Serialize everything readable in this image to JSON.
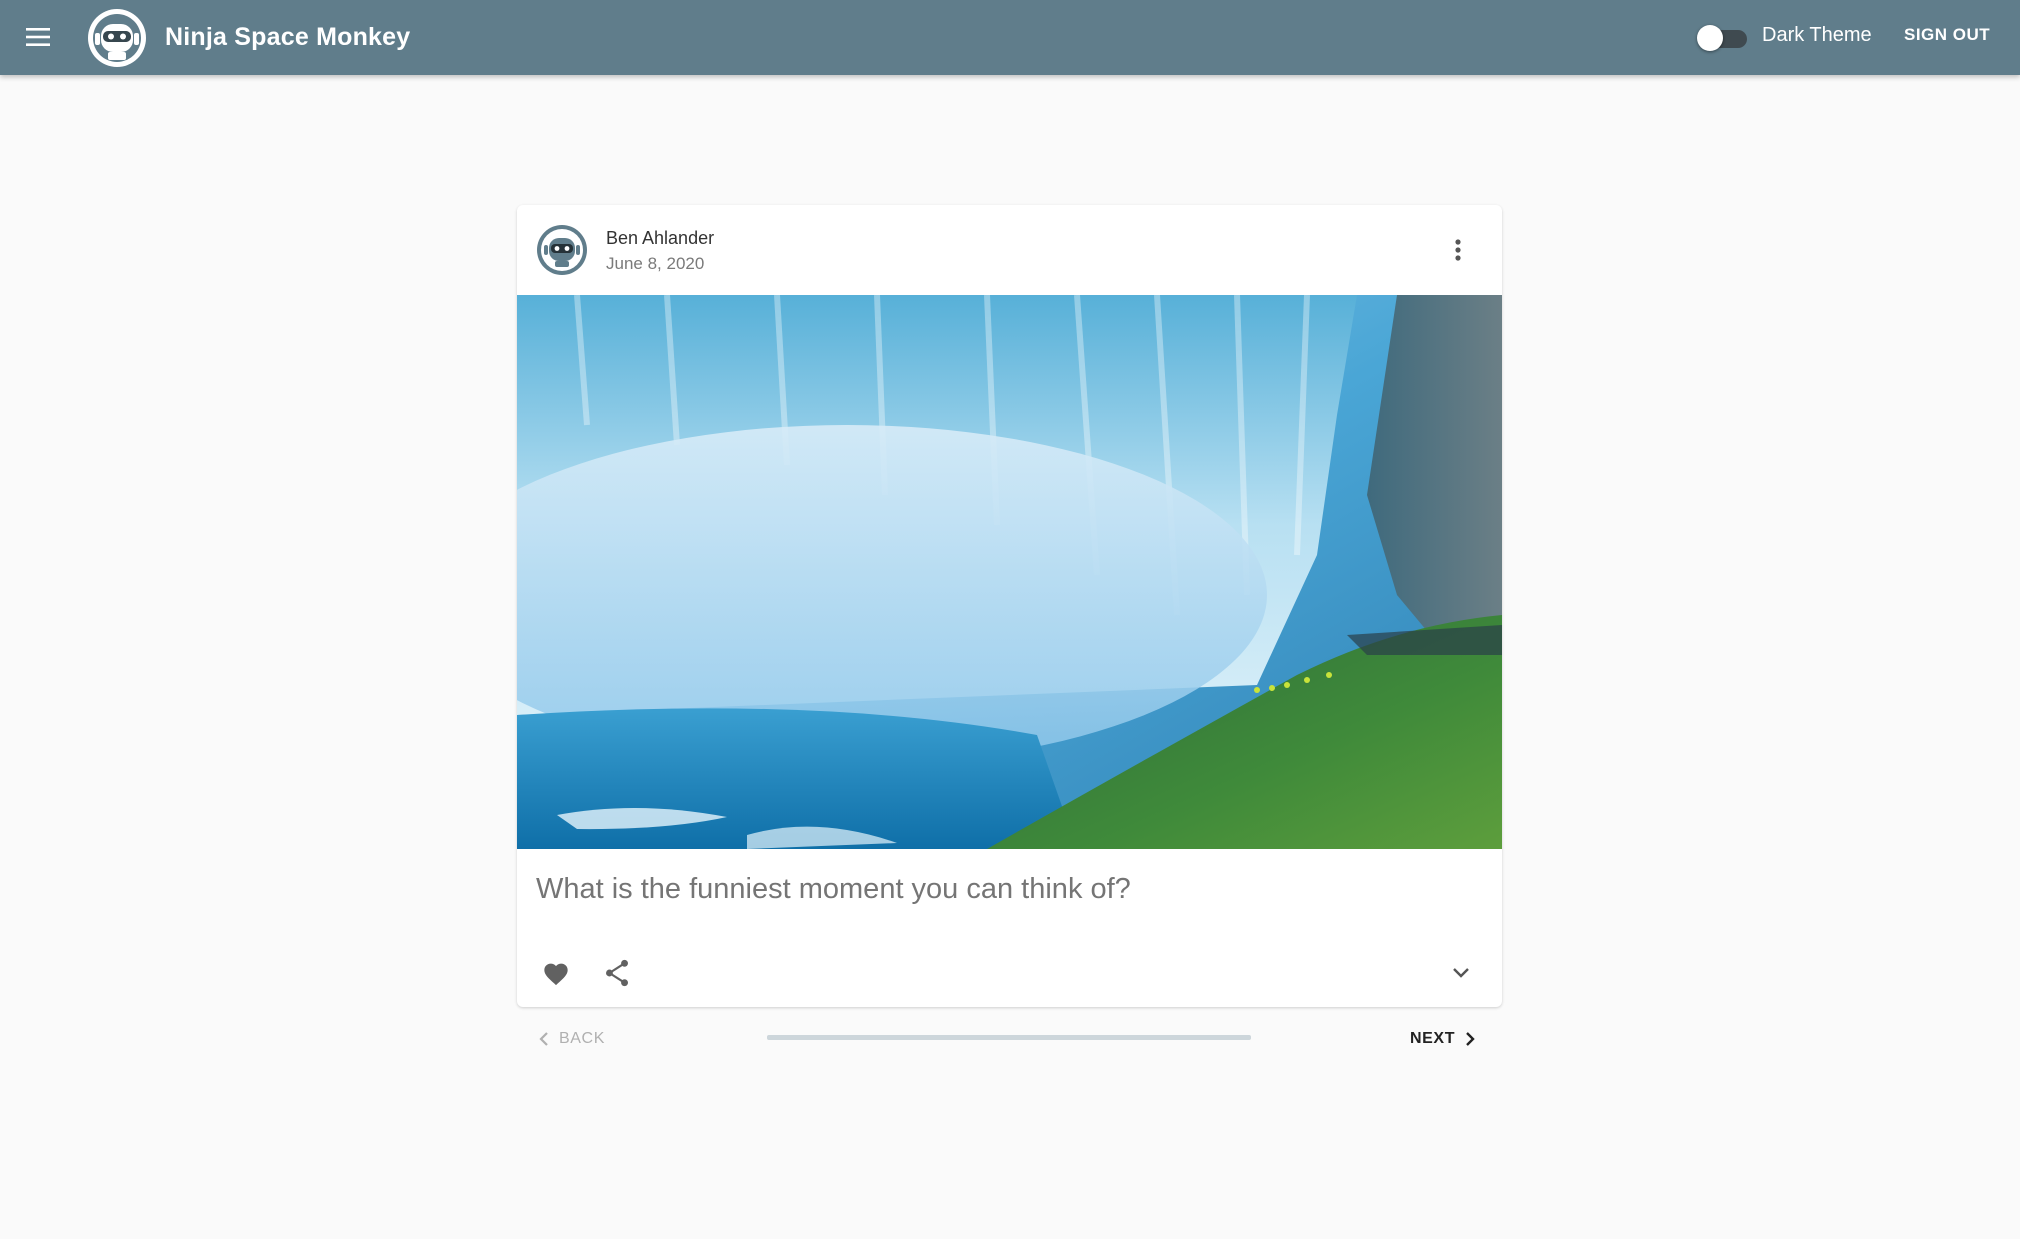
{
  "appbar": {
    "title": "Ninja Space Monkey",
    "theme_label": "Dark Theme",
    "theme_toggle_on": false,
    "signout_label": "SIGN OUT",
    "color": "#607d8b"
  },
  "card": {
    "author": "Ben Ahlander",
    "date": "June 8, 2020",
    "question": "What is the funniest moment you can think of?",
    "image_subject": "waterfall"
  },
  "stepper": {
    "back_label": "BACK",
    "next_label": "NEXT",
    "progress": 0
  },
  "icons": {
    "menu": "menu-icon",
    "logo": "robot-logo-icon",
    "more": "more-vert-icon",
    "like": "heart-icon",
    "share": "share-icon",
    "expand": "chevron-down-icon",
    "back": "chevron-left-icon",
    "next": "chevron-right-icon"
  }
}
